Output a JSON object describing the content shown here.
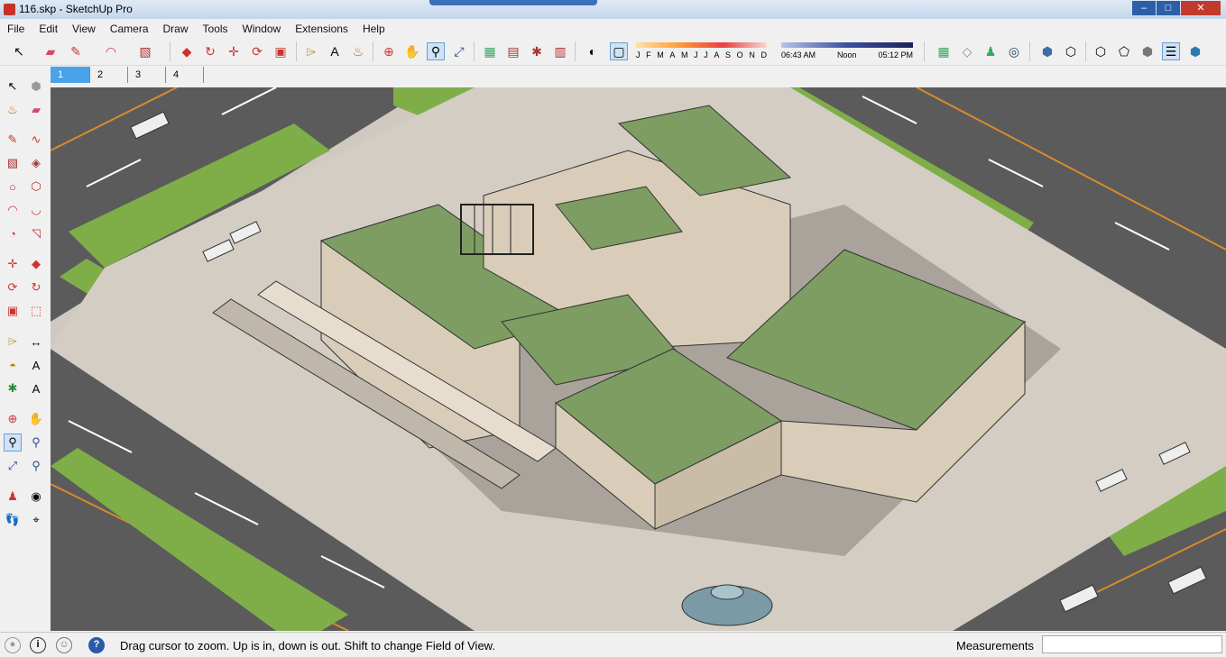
{
  "window": {
    "title": "116.skp - SketchUp Pro"
  },
  "menu": [
    "File",
    "Edit",
    "View",
    "Camera",
    "Draw",
    "Tools",
    "Window",
    "Extensions",
    "Help"
  ],
  "shadow_settings": {
    "months": [
      "J",
      "F",
      "M",
      "A",
      "M",
      "J",
      "J",
      "A",
      "S",
      "O",
      "N",
      "D"
    ],
    "time_start": "06:43 AM",
    "time_mid": "Noon",
    "time_end": "05:12 PM"
  },
  "scenes": [
    "1",
    "2",
    "3",
    "4"
  ],
  "status": {
    "hint": "Drag cursor to zoom.  Up is in, down is out. Shift to change Field of View.",
    "measurements_label": "Measurements",
    "measurements_value": ""
  },
  "colors": {
    "road": "#5a5a5a",
    "grass": "#7fae48",
    "plaza": "#cfc9c1",
    "roof": "#7d9d62",
    "facade": "#d9cdb9",
    "lane_white": "#ffffff",
    "lane_orange": "#d98a2c"
  }
}
